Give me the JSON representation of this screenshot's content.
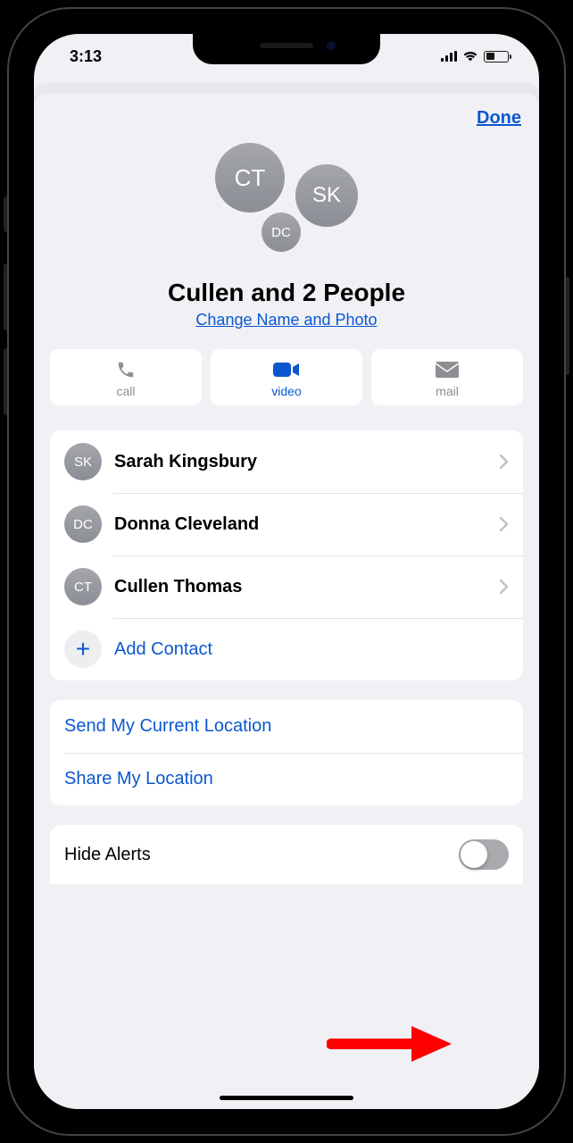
{
  "status": {
    "time": "3:13"
  },
  "header": {
    "done": "Done"
  },
  "group": {
    "avatars": {
      "ct": "CT",
      "sk": "SK",
      "dc": "DC"
    },
    "name": "Cullen and 2 People",
    "change_link": "Change Name and Photo"
  },
  "actions": {
    "call": "call",
    "video": "video",
    "mail": "mail"
  },
  "contacts": [
    {
      "initials": "SK",
      "name": "Sarah Kingsbury"
    },
    {
      "initials": "DC",
      "name": "Donna Cleveland"
    },
    {
      "initials": "CT",
      "name": "Cullen Thomas"
    }
  ],
  "add_contact": "Add Contact",
  "location": {
    "send": "Send My Current Location",
    "share": "Share My Location"
  },
  "hide_alerts": {
    "label": "Hide Alerts",
    "enabled": false
  }
}
